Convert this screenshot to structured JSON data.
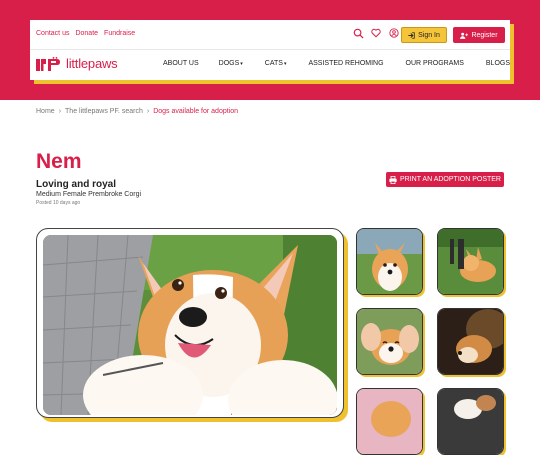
{
  "header": {
    "utility_links": [
      "Contact us",
      "Donate",
      "Fundraise"
    ],
    "icons": [
      "search-icon",
      "heart-icon",
      "user-circle-icon"
    ],
    "signin_label": "Sign In",
    "register_label": "Register",
    "logo_text": "littlepaws",
    "nav": [
      {
        "label": "ABOUT US",
        "has_caret": false
      },
      {
        "label": "DOGS",
        "has_caret": true
      },
      {
        "label": "CATS",
        "has_caret": true
      },
      {
        "label": "ASSISTED REHOMING",
        "has_caret": false
      },
      {
        "label": "OUR PROGRAMS",
        "has_caret": false
      },
      {
        "label": "BLOGS",
        "has_caret": false
      }
    ]
  },
  "breadcrumb": {
    "home": "Home",
    "search": "The littlepaws PF. search",
    "current": "Dogs available for adoption"
  },
  "pet": {
    "name": "Nem",
    "tagline": "Loving and royal",
    "descriptor": "Medium Female Prembroke Corgi",
    "posted": "Posted 10 days ago"
  },
  "actions": {
    "print_poster_label": "PRINT AN ADOPTION POSTER"
  },
  "colors": {
    "brand": "#d81f4a",
    "accent": "#f0c12f"
  }
}
